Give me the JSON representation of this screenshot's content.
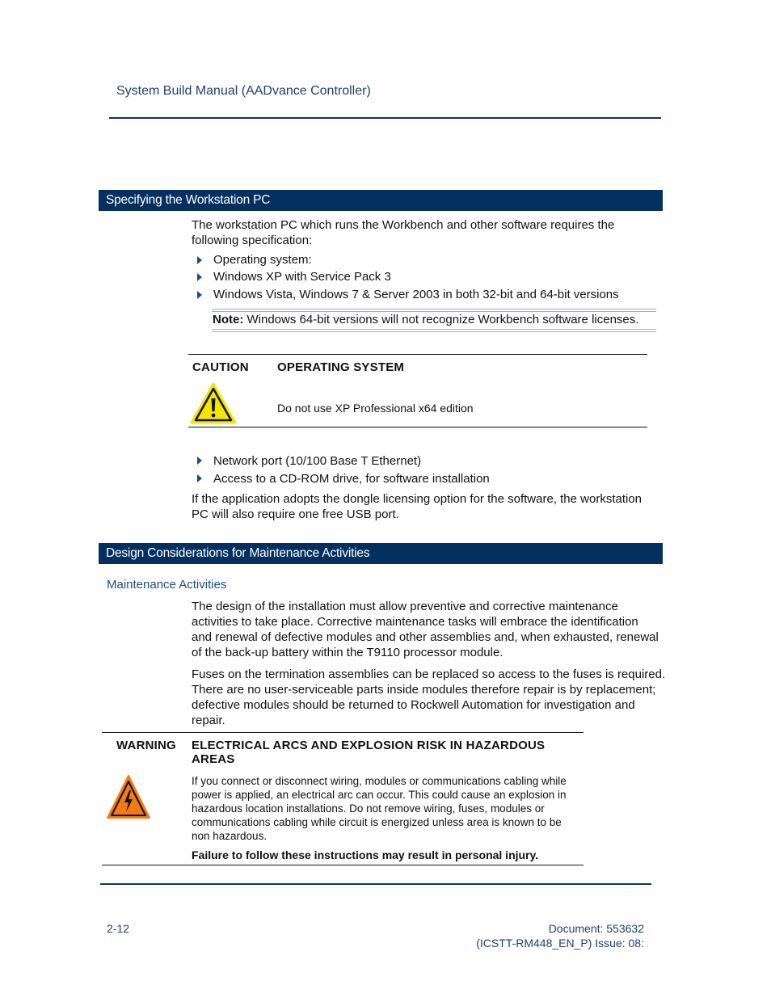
{
  "header": {
    "title": "System Build Manual  (AADvance Controller)"
  },
  "sections": [
    {
      "title": "Specifying the Workstation PC",
      "intro": [
        "The workstation PC which runs the Workbench and other software requires the",
        "following specification:"
      ],
      "bullets": [
        "Operating system:",
        "Windows XP with Service Pack 3",
        "Windows Vista, Windows 7 & Server 2003 in both 32-bit and 64-bit versions"
      ],
      "note": {
        "label": "Note:",
        "text": " Windows 64-bit versions will not recognize Workbench software licenses."
      },
      "caution": {
        "label": "CAUTION",
        "title": "OPERATING SYSTEM",
        "text": "Do not use XP Professional x64 edition",
        "icon": "warning-triangle-icon"
      },
      "bullets2": [
        "Network port (10/100 Base T Ethernet)",
        "Access to a CD-ROM drive, for software installation"
      ],
      "closing": [
        "If the application adopts the dongle licensing option for the software, the workstation",
        "PC will also require one free USB port."
      ]
    },
    {
      "title": "Design Considerations for Maintenance Activities",
      "subheading": "Maintenance Activities",
      "paragraphs": [
        [
          "The design of the installation must allow preventive and corrective maintenance",
          "activities to take place. Corrective maintenance tasks will embrace the identification",
          "and renewal of defective modules and other assemblies and, when exhausted, renewal",
          "of the back-up battery within the T9110 processor module."
        ],
        [
          "Fuses on the termination assemblies can be replaced so access to the fuses is required.",
          "There are no user-serviceable parts inside modules therefore repair is by replacement;",
          "defective modules should be returned to Rockwell Automation for investigation and",
          "repair."
        ]
      ],
      "warning": {
        "label": "WARNING",
        "title": [
          "ELECTRICAL ARCS AND EXPLOSION RISK IN HAZARDOUS",
          "AREAS"
        ],
        "text": [
          "If you connect or disconnect wiring, modules or communications cabling while",
          "power is applied, an electrical arc can occur. This could cause an explosion in",
          "hazardous location installations. Do not remove wiring, fuses, modules or",
          "communications cabling while circuit is energized unless area is known to be",
          "non hazardous."
        ],
        "footer": "Failure to follow these instructions may result in personal injury.",
        "icon": "electrical-hazard-icon"
      }
    }
  ],
  "footer": {
    "page": "2-12",
    "document": "Document: 553632",
    "issue": "(ICSTT-RM448_EN_P) Issue: 08:"
  }
}
